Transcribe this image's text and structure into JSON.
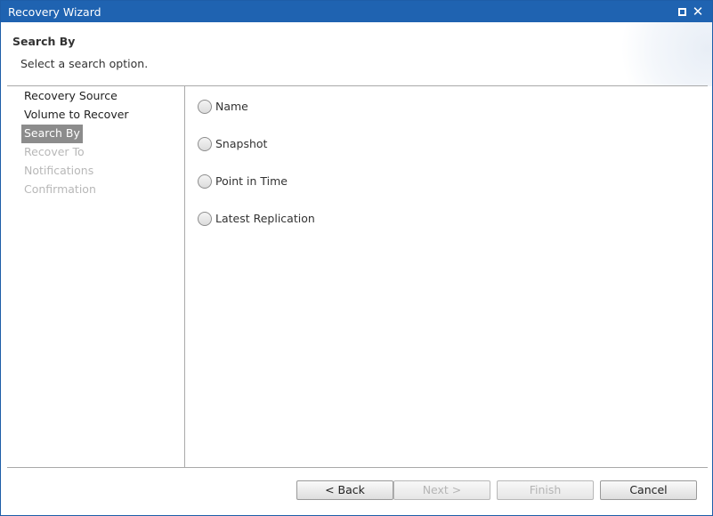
{
  "window": {
    "title": "Recovery Wizard",
    "icons": {
      "maximize": "maximize-icon",
      "close": "close-icon"
    },
    "close_glyph": "✕"
  },
  "header": {
    "step_title": "Search By",
    "step_description": "Select a search option."
  },
  "steps": [
    {
      "label": "Recovery Source",
      "state": "done"
    },
    {
      "label": "Volume to Recover",
      "state": "done"
    },
    {
      "label": "Search By",
      "state": "current"
    },
    {
      "label": "Recover To",
      "state": "disabled"
    },
    {
      "label": "Notifications",
      "state": "disabled"
    },
    {
      "label": "Confirmation",
      "state": "disabled"
    }
  ],
  "search_options": [
    {
      "label": "Name",
      "selected": false
    },
    {
      "label": "Snapshot",
      "selected": false
    },
    {
      "label": "Point in Time",
      "selected": false
    },
    {
      "label": "Latest Replication",
      "selected": false
    }
  ],
  "buttons": {
    "back": {
      "label": "< Back",
      "enabled": true
    },
    "next": {
      "label": "Next >",
      "enabled": false
    },
    "finish": {
      "label": "Finish",
      "enabled": false
    },
    "cancel": {
      "label": "Cancel",
      "enabled": true
    }
  },
  "colors": {
    "titlebar": "#1f63b1",
    "current_step_bg": "#8c8c8c",
    "disabled_text": "#b8b8b8"
  }
}
